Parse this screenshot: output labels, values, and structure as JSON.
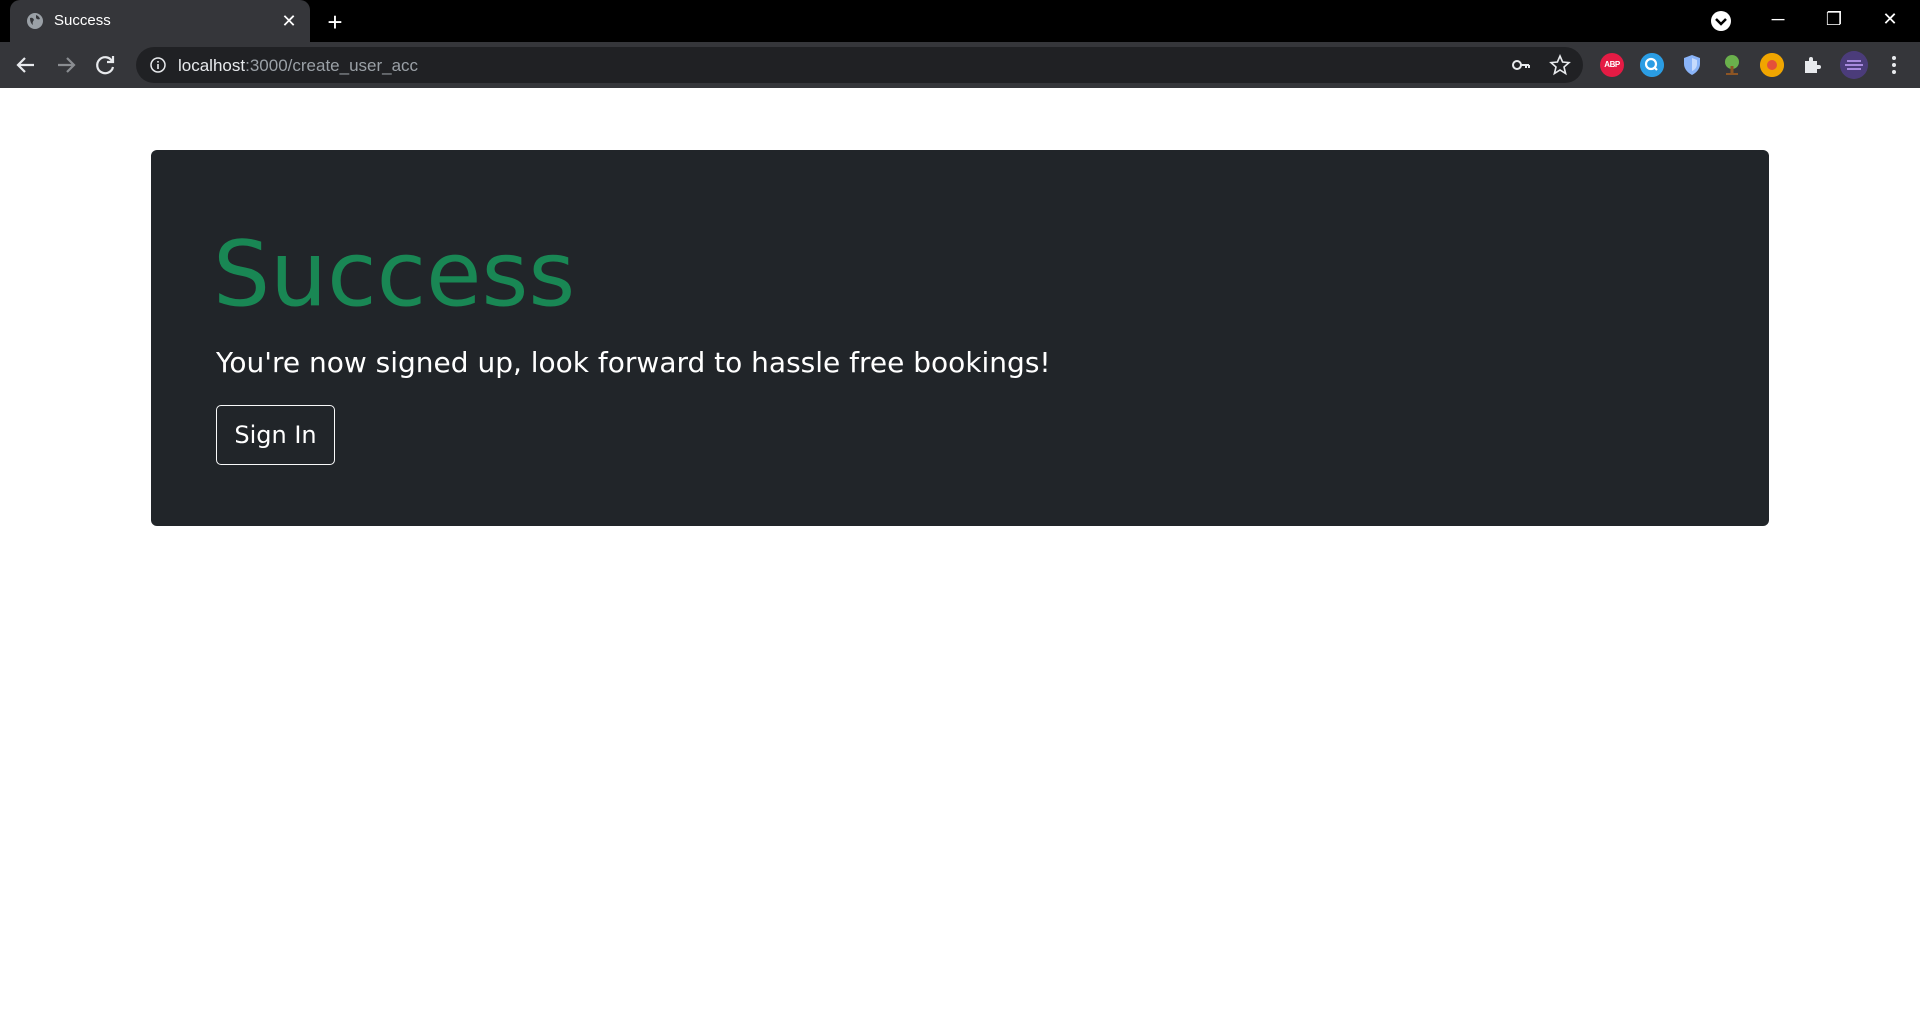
{
  "browser": {
    "tab": {
      "title": "Success"
    },
    "address": {
      "host": "localhost",
      "path": ":3000/create_user_acc"
    },
    "extensions": {
      "abp_label": "ABP"
    }
  },
  "page": {
    "heading": "Success",
    "message": "You're now signed up, look forward to hassle free bookings!",
    "sign_in_label": "Sign In"
  },
  "colors": {
    "heading": "#198754",
    "jumbotron": "#212529",
    "chrome_bg": "#35363a"
  }
}
